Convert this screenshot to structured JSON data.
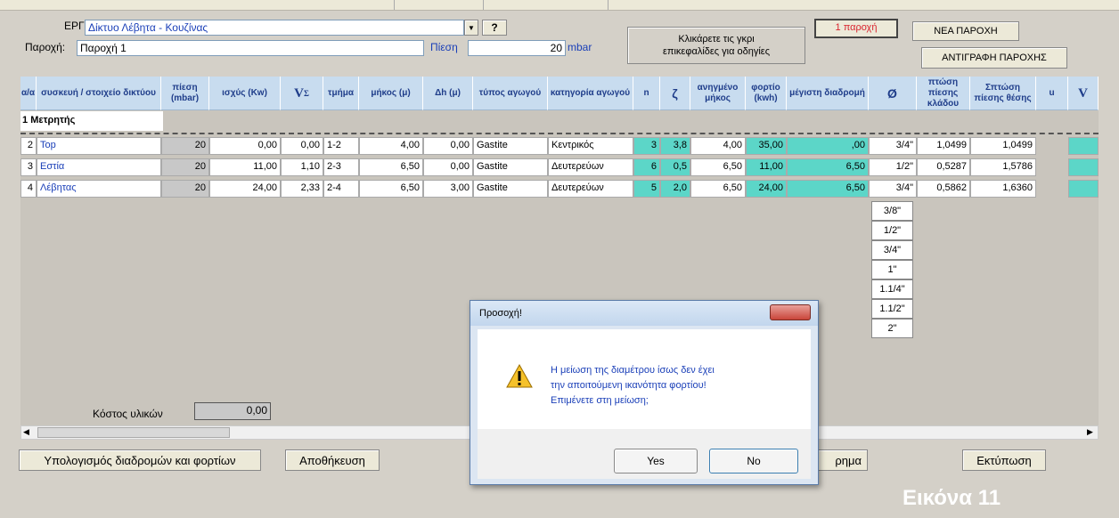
{
  "header": {
    "project_label": "ΕΡΓΟ:",
    "project_value": "Δίκτυο Λέβητα - Κουζίνας",
    "help_button": "?",
    "supply_label": "Παροχή:",
    "supply_value": "Παροχή 1",
    "pressure_label": "Πίεση",
    "pressure_value": "20",
    "pressure_unit": "mbar",
    "hint_line1": "Κλικάρετε τις γκρι",
    "hint_line2": "επικεφαλίδες για οδηγίες",
    "supply_count": "1 παροχή",
    "new_supply_button": "ΝΕΑ ΠΑΡΟΧΗ",
    "copy_supply_button": "ΑΝΤΙΓΡΑΦΗ ΠΑΡΟΧΗΣ"
  },
  "columns": [
    "α/α",
    "συσκευή / στοιχείο δικτύου",
    "πίεση (mbar)",
    "ισχύς (Kw)",
    "V",
    "τμήμα",
    "μήκος (μ)",
    "Δh (μ)",
    "τύπος αγωγού",
    "κατηγορία αγωγού",
    "n",
    "ζ",
    "ανηγμένο μήκος",
    "φορτίο (kwh)",
    "μέγιστη διαδρομή",
    "Ø",
    "πτώση πίεσης κλάδου",
    "Σπτώση πίεσης θέσης",
    "u",
    "V"
  ],
  "v_sub": "Σ",
  "meter_row": {
    "num": "1",
    "name": "Μετρητής"
  },
  "rows": [
    {
      "num": "2",
      "name": "Top",
      "pressure": "20",
      "power": "0,00",
      "vs": "0,00",
      "segment": "1-2",
      "length": "4,00",
      "dh": "0,00",
      "pipe": "Gastite",
      "category": "Κεντρικός",
      "n": "3",
      "z": "3,8",
      "eq_len": "4,00",
      "load": "35,00",
      "maxroute": ",00",
      "dia": "3/4\"",
      "drop": "1,0499",
      "sumdrop": "1,0499"
    },
    {
      "num": "3",
      "name": "Εστία",
      "pressure": "20",
      "power": "11,00",
      "vs": "1,10",
      "segment": "2-3",
      "length": "6,50",
      "dh": "0,00",
      "pipe": "Gastite",
      "category": "Δευτερεύων",
      "n": "6",
      "z": "0,5",
      "eq_len": "6,50",
      "load": "11,00",
      "maxroute": "6,50",
      "dia": "1/2\"",
      "drop": "0,5287",
      "sumdrop": "1,5786"
    },
    {
      "num": "4",
      "name": "Λέβητας",
      "pressure": "20",
      "power": "24,00",
      "vs": "2,33",
      "segment": "2-4",
      "length": "6,50",
      "dh": "3,00",
      "pipe": "Gastite",
      "category": "Δευτερεύων",
      "n": "5",
      "z": "2,0",
      "eq_len": "6,50",
      "load": "24,00",
      "maxroute": "6,50",
      "dia": "3/4\"",
      "drop": "0,5862",
      "sumdrop": "1,6360"
    }
  ],
  "diameter_options": [
    "3/8\"",
    "1/2\"",
    "3/4\"",
    "1\"",
    "1.1/4\"",
    "1.1/2\"",
    "2\""
  ],
  "cost": {
    "label": "Κόστος υλικών",
    "value": "0,00"
  },
  "footer": {
    "calc_button": "Υπολογισμός διαδρομών και φορτίων",
    "save_button": "Αποθήκευση",
    "partial_button": "ρημα",
    "print_button": "Εκτύπωση"
  },
  "dialog": {
    "title": "Προσοχή!",
    "line1": "Η μείωση της διαμέτρου ίσως δεν έχει",
    "line2": "την αποιτούμενη ικανότητα φορτίου!",
    "line3": "Επιμένετε στη μείωση;",
    "yes": "Yes",
    "no": "No"
  },
  "figure_caption": "Εικόνα 11",
  "colors": {
    "header_bg": "#c8dcef",
    "teal": "#5cd6c8",
    "accent_red": "#d9232e",
    "caption_bg": "#d4d0c8"
  },
  "icons": [
    "warning-icon",
    "dropdown-arrow-icon",
    "scroll-left-icon",
    "scroll-right-icon",
    "close-icon"
  ]
}
